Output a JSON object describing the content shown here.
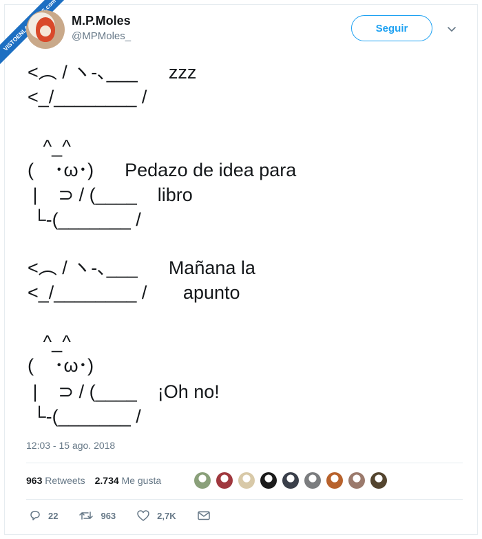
{
  "watermark": {
    "text": "VISTOENLASREDES",
    "suffix": ".com"
  },
  "author": {
    "name": "M.P.Moles",
    "handle": "@MPMoles_"
  },
  "follow_label": "Seguir",
  "tweet_lines": [
    "<︵ / ヽ-､___      zzz",
    "<_/________ /",
    "   ^_^",
    "(    ･ω･)      Pedazo de idea para",
    " |    ⊃ / (____    libro",
    " └-(_______ /",
    "<︵ / ヽ-､___      Mañana la",
    "<_/________ /       apunto",
    "   ^_^",
    "(    ･ω･)",
    " |    ⊃ / (____    ¡Oh no!",
    " └-(_______ /"
  ],
  "timestamp": "12:03 - 15 ago. 2018",
  "stats": {
    "retweets_count": "963",
    "retweets_label": "Retweets",
    "likes_count": "2.734",
    "likes_label": "Me gusta"
  },
  "liker_avatar_colors": [
    "#8aa07a",
    "#a0383e",
    "#d8c9a8",
    "#1b1b1b",
    "#3a3f4a",
    "#7b7d7f",
    "#b8622c",
    "#9b7a6c",
    "#54452f"
  ],
  "actions": {
    "replies": "22",
    "retweets": "963",
    "likes": "2,7K"
  },
  "colors": {
    "accent": "#1da1f2",
    "muted": "#657786",
    "ribbon": "#1d6fc2"
  }
}
